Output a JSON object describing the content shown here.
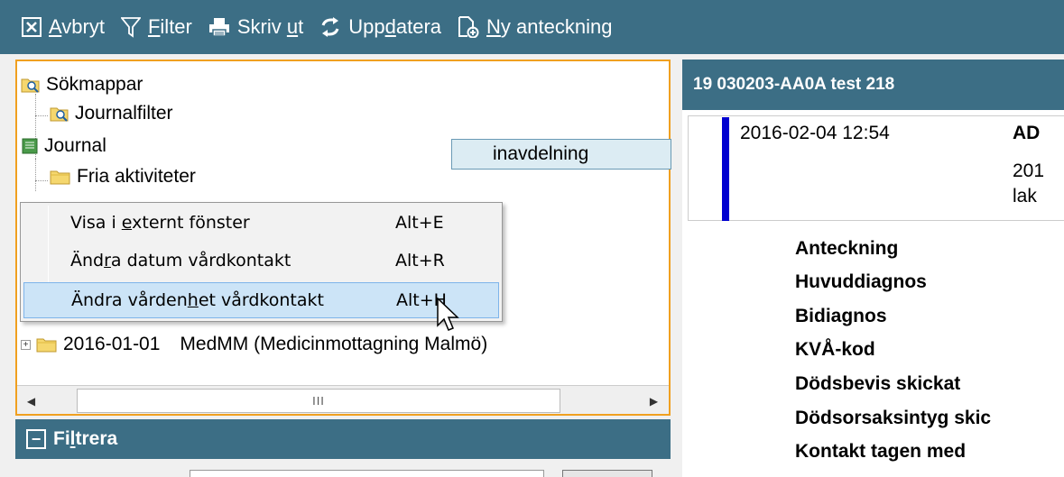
{
  "toolbar": {
    "cancel": {
      "pre": "",
      "u": "A",
      "post": "vbryt"
    },
    "filter": {
      "pre": "",
      "u": "F",
      "post": "ilter"
    },
    "print": {
      "pre": "Skriv ",
      "u": "u",
      "post": "t"
    },
    "refresh": {
      "pre": "Upp",
      "u": "d",
      "post": "atera"
    },
    "new_note": {
      "pre": "",
      "u": "N",
      "post": "y anteckning"
    }
  },
  "tree": {
    "search_folders": "Sökmappar",
    "journal_filter": "Journalfilter",
    "journal": "Journal",
    "free_activities": "Fria aktiviteter",
    "selected_partial": "inavdelning",
    "visit_date": "2016-01-01",
    "visit_unit": "MedMM (Medicinmottagning Malmö)"
  },
  "scrollbar": {
    "thumb_grip": "III"
  },
  "filter_panel": {
    "title_pre": "Fi",
    "title_u": "l",
    "title_post": "trera"
  },
  "context_menu": {
    "items": [
      {
        "pre": "Visa i ",
        "u": "e",
        "post": "xternt fönster",
        "shortcut": "Alt+E"
      },
      {
        "pre": "Änd",
        "u": "r",
        "post": "a datum vårdkontakt",
        "shortcut": "Alt+R"
      },
      {
        "pre": "Ändra vården",
        "u": "h",
        "post": "et vårdkontakt",
        "shortcut": "Alt+H"
      }
    ]
  },
  "patient": {
    "header": "19 030203-AA0A test 218",
    "entry_date": "2016-02-04 12:54",
    "entry_title": "AD",
    "entry_line1": "201",
    "entry_line2": "lak",
    "fields": [
      "Anteckning",
      "Huvuddiagnos",
      "Bidiagnos",
      "KVÅ-kod",
      "Dödsbevis skickat",
      "Dödsorsaksintyg skic",
      "Kontakt tagen med"
    ]
  },
  "colors": {
    "header_bg": "#3c6e85",
    "panel_border": "#f0a020",
    "entry_bar": "#0000d0",
    "menu_highlight": "#cce4f7"
  }
}
